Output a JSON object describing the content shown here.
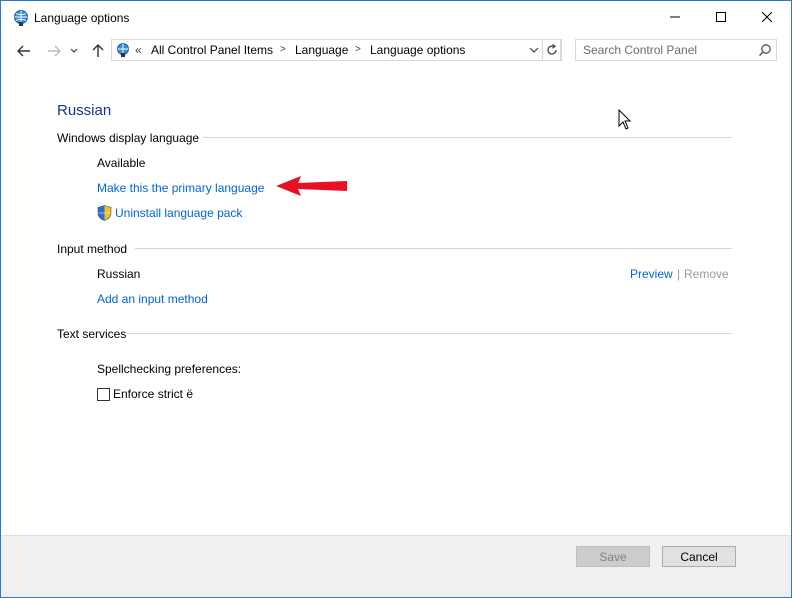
{
  "window": {
    "title": "Language options",
    "icon": "language-globe-icon"
  },
  "window_controls": {
    "minimize": "minimize-icon",
    "maximize": "maximize-icon",
    "close": "close-icon"
  },
  "nav": {
    "back": "back-arrow-icon",
    "forward": "forward-arrow-icon",
    "recent": "chevron-down-icon",
    "up": "up-arrow-icon"
  },
  "address_bar": {
    "overflow": "«",
    "crumbs": [
      "All Control Panel Items",
      "Language",
      "Language options"
    ],
    "separator": ">"
  },
  "search": {
    "placeholder": "Search Control Panel"
  },
  "language": {
    "name": "Russian"
  },
  "display_language": {
    "heading": "Windows display language",
    "status": "Available",
    "make_primary": "Make this the primary language",
    "uninstall": "Uninstall language pack"
  },
  "input_method": {
    "heading": "Input method",
    "method_name": "Russian",
    "preview": "Preview",
    "divider": "|",
    "remove": "Remove",
    "add": "Add an input method"
  },
  "text_services": {
    "heading": "Text services",
    "spellcheck_label": "Spellchecking preferences:",
    "enforce_label": "Enforce strict ë",
    "enforce_checked": false
  },
  "footer": {
    "save": "Save",
    "cancel": "Cancel"
  },
  "colors": {
    "accent_link": "#0066cc",
    "title_blue": "#1e3287",
    "annotation_arrow": "#e81123"
  }
}
